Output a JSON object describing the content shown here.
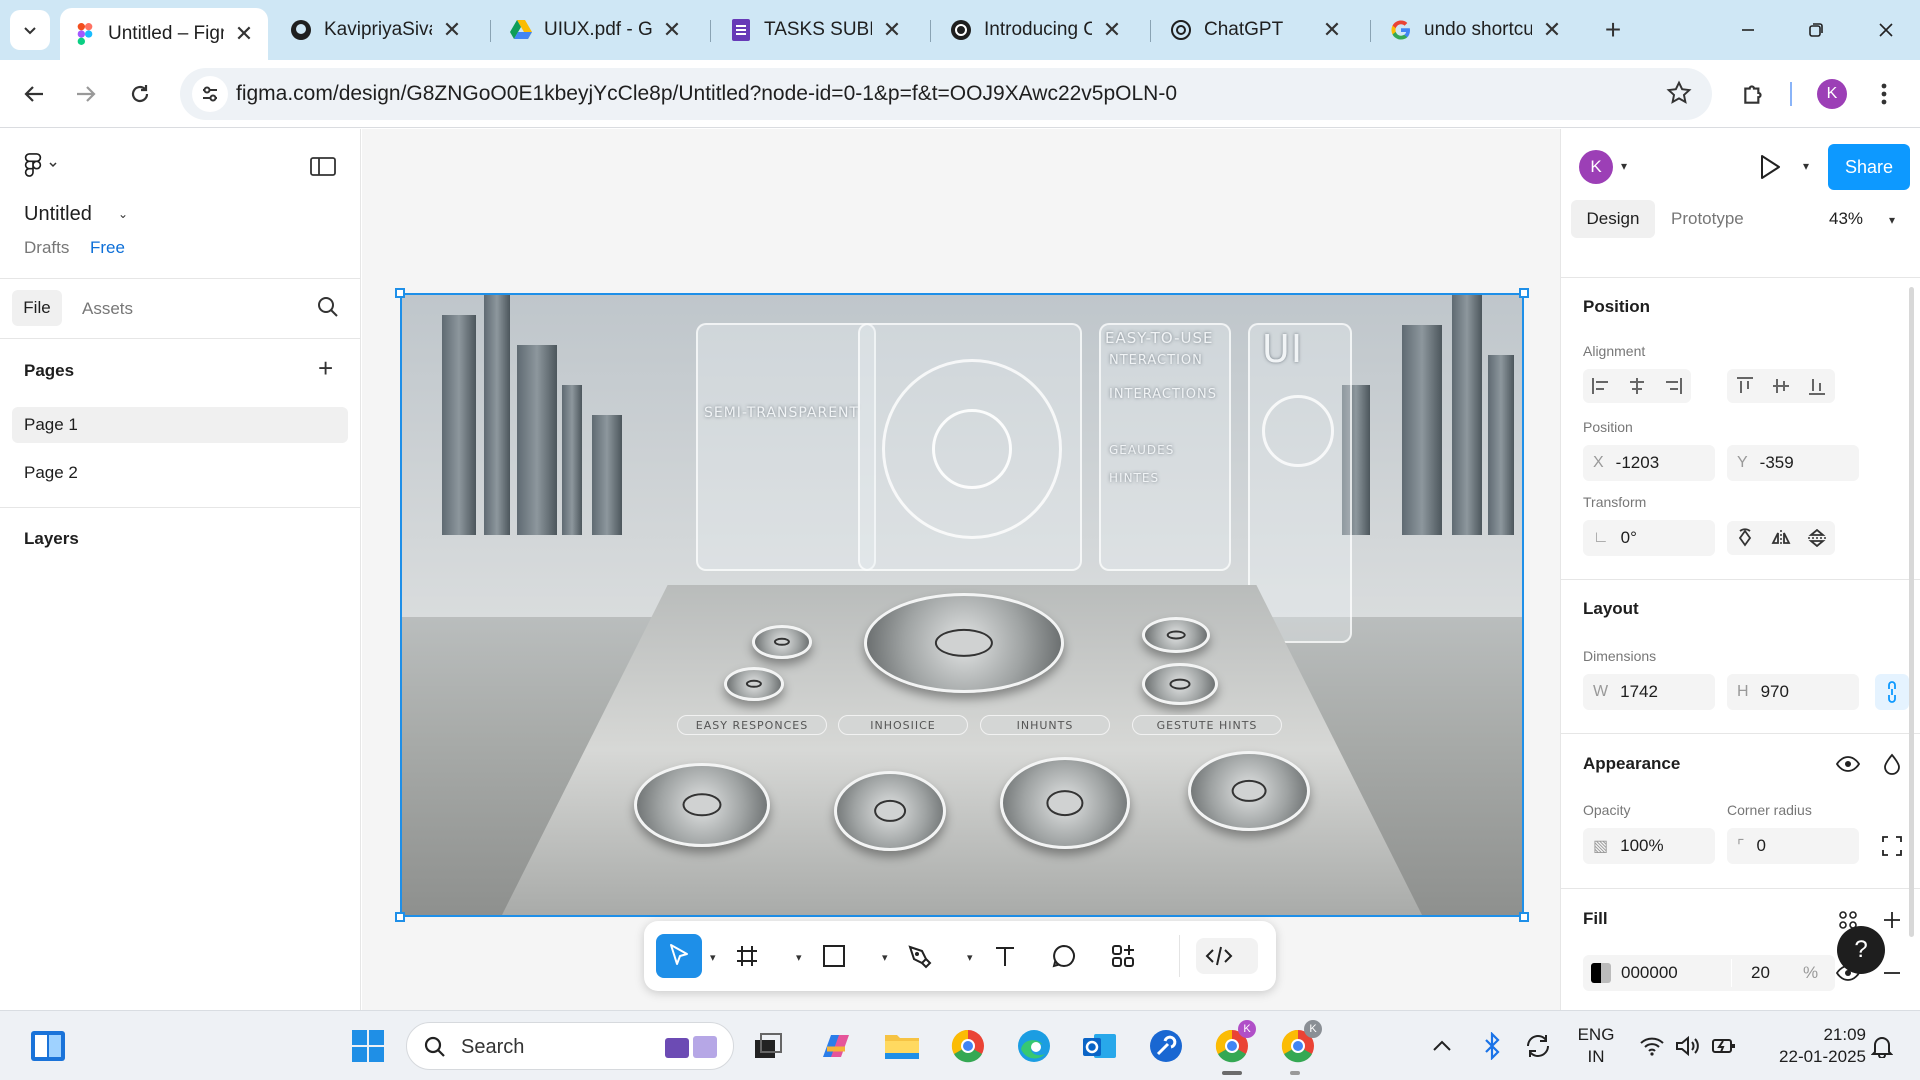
{
  "browser": {
    "tabs": [
      {
        "title": "Untitled – Figma",
        "icon": "figma-icon",
        "active": true
      },
      {
        "title": "KavipriyaSivar",
        "icon": "github-icon"
      },
      {
        "title": "UIUX.pdf - Go",
        "icon": "google-drive-icon"
      },
      {
        "title": "TASKS SUBMIS",
        "icon": "google-forms-icon"
      },
      {
        "title": "Introducing Cl",
        "icon": "openai-icon"
      },
      {
        "title": "ChatGPT",
        "icon": "openai-icon"
      },
      {
        "title": "undo shortcut",
        "icon": "google-icon"
      }
    ],
    "url": "figma.com/design/G8ZNGoO0E1kbeyjYcCle8p/Untitled?node-id=0-1&p=f&t=OOJ9XAwc22v5pOLN-0",
    "profile_initial": "K"
  },
  "figma": {
    "file_name": "Untitled",
    "location": "Drafts",
    "plan": "Free",
    "left_tabs": {
      "file": "File",
      "assets": "Assets"
    },
    "pages_title": "Pages",
    "pages": [
      "Page 1",
      "Page 2"
    ],
    "selected_page": "Page 1",
    "layers_title": "Layers",
    "canvas_image_text": {
      "panel_1": "SEMI-TRANSPARENT",
      "panel_3_title": "EASY-TO-USE",
      "panel_3_lines": [
        "NTERACTION",
        "INTERACTIONS",
        "GEAUDES",
        "HINTES"
      ],
      "panel_4_title": "UI",
      "pills": [
        "EASY RESPONCES",
        "INHOSIICE",
        "INHUNTS",
        "GESTUTE HINTS"
      ]
    }
  },
  "right_panel": {
    "avatar_initial": "K",
    "share_label": "Share",
    "tabs": {
      "design": "Design",
      "prototype": "Prototype"
    },
    "zoom": "43%",
    "position": {
      "title": "Position",
      "alignment_label": "Alignment",
      "position_label": "Position",
      "x_prefix": "X",
      "x": "-1203",
      "y_prefix": "Y",
      "y": "-359",
      "transform_label": "Transform",
      "rotation": "0°"
    },
    "layout": {
      "title": "Layout",
      "dimensions_label": "Dimensions",
      "w_prefix": "W",
      "w": "1742",
      "h_prefix": "H",
      "h": "970"
    },
    "appearance": {
      "title": "Appearance",
      "opacity_label": "Opacity",
      "opacity": "100%",
      "radius_label": "Corner radius",
      "radius": "0"
    },
    "fill": {
      "title": "Fill",
      "hex": "000000",
      "opacity": "20",
      "unit": "%"
    },
    "help": "?"
  },
  "taskbar": {
    "search_placeholder": "Search",
    "lang_top": "ENG",
    "lang_bottom": "IN",
    "time": "21:09",
    "date": "22-01-2025"
  },
  "colors": {
    "figma_blue": "#0D99FF",
    "selection": "#1E8FE8",
    "avatar_purple": "#9C3FB6",
    "chrome_tabbar": "#CFE7F5"
  }
}
